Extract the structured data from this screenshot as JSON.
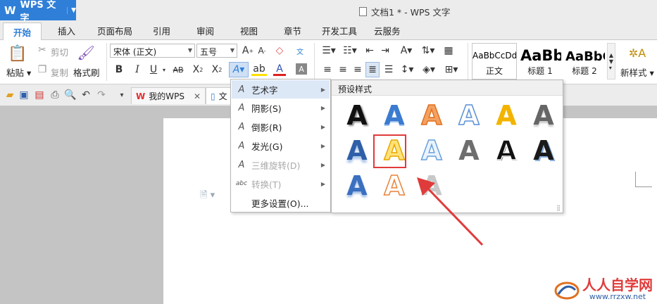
{
  "app": {
    "name": "WPS 文字",
    "window_title": "文档1 * - WPS 文字"
  },
  "tabs": [
    "开始",
    "插入",
    "页面布局",
    "引用",
    "审阅",
    "视图",
    "章节",
    "开发工具",
    "云服务"
  ],
  "ribbon": {
    "clipboard": {
      "paste": "粘贴",
      "cut": "剪切",
      "copy": "复制",
      "format_painter": "格式刷"
    },
    "font": {
      "family": "宋体 (正文)",
      "size": "五号"
    },
    "styles": [
      {
        "preview": "AaBbCcDd",
        "name": "正文"
      },
      {
        "preview": "AaBb",
        "name": "标题 1"
      },
      {
        "preview": "AaBbC",
        "name": "标题 2"
      }
    ],
    "new_style": "新样式"
  },
  "quickbar": {
    "my_wps": "我的WPS",
    "doc_tab": "文"
  },
  "effects_menu": {
    "items": [
      {
        "icon": "A",
        "label": "艺术字",
        "has_sub": true,
        "disabled": false
      },
      {
        "icon": "A",
        "label": "阴影(S)",
        "has_sub": true,
        "disabled": false
      },
      {
        "icon": "A",
        "label": "倒影(R)",
        "has_sub": true,
        "disabled": false
      },
      {
        "icon": "A",
        "label": "发光(G)",
        "has_sub": true,
        "disabled": false
      },
      {
        "icon": "A",
        "label": "三维旋转(D)",
        "has_sub": true,
        "disabled": true
      },
      {
        "icon": "abc",
        "label": "转换(T)",
        "has_sub": true,
        "disabled": true
      },
      {
        "icon": "",
        "label": "更多设置(O)...",
        "has_sub": false,
        "disabled": false
      }
    ]
  },
  "art_gallery": {
    "header": "预设样式",
    "glyph": "A",
    "selected_index": 7,
    "items": [
      {
        "style": "black-shadow"
      },
      {
        "style": "blue-gradient"
      },
      {
        "style": "orange-outline"
      },
      {
        "style": "blue-outline"
      },
      {
        "style": "yellow-gradient"
      },
      {
        "style": "gray-reflection"
      },
      {
        "style": "blue-reflection"
      },
      {
        "style": "yellow-outline"
      },
      {
        "style": "lightblue-outline"
      },
      {
        "style": "gray-solid"
      },
      {
        "style": "black-white-outline"
      },
      {
        "style": "black-blue-outline"
      },
      {
        "style": "blue-shadow"
      },
      {
        "style": "orange-thin"
      },
      {
        "style": "gray-faded"
      }
    ]
  },
  "watermark": {
    "title": "人人自学网",
    "url": "www.rrzxw.net"
  },
  "colors": {
    "accent": "#2f7fd8",
    "highlight_border": "#e03b3b",
    "arrow": "#e03b3b"
  }
}
